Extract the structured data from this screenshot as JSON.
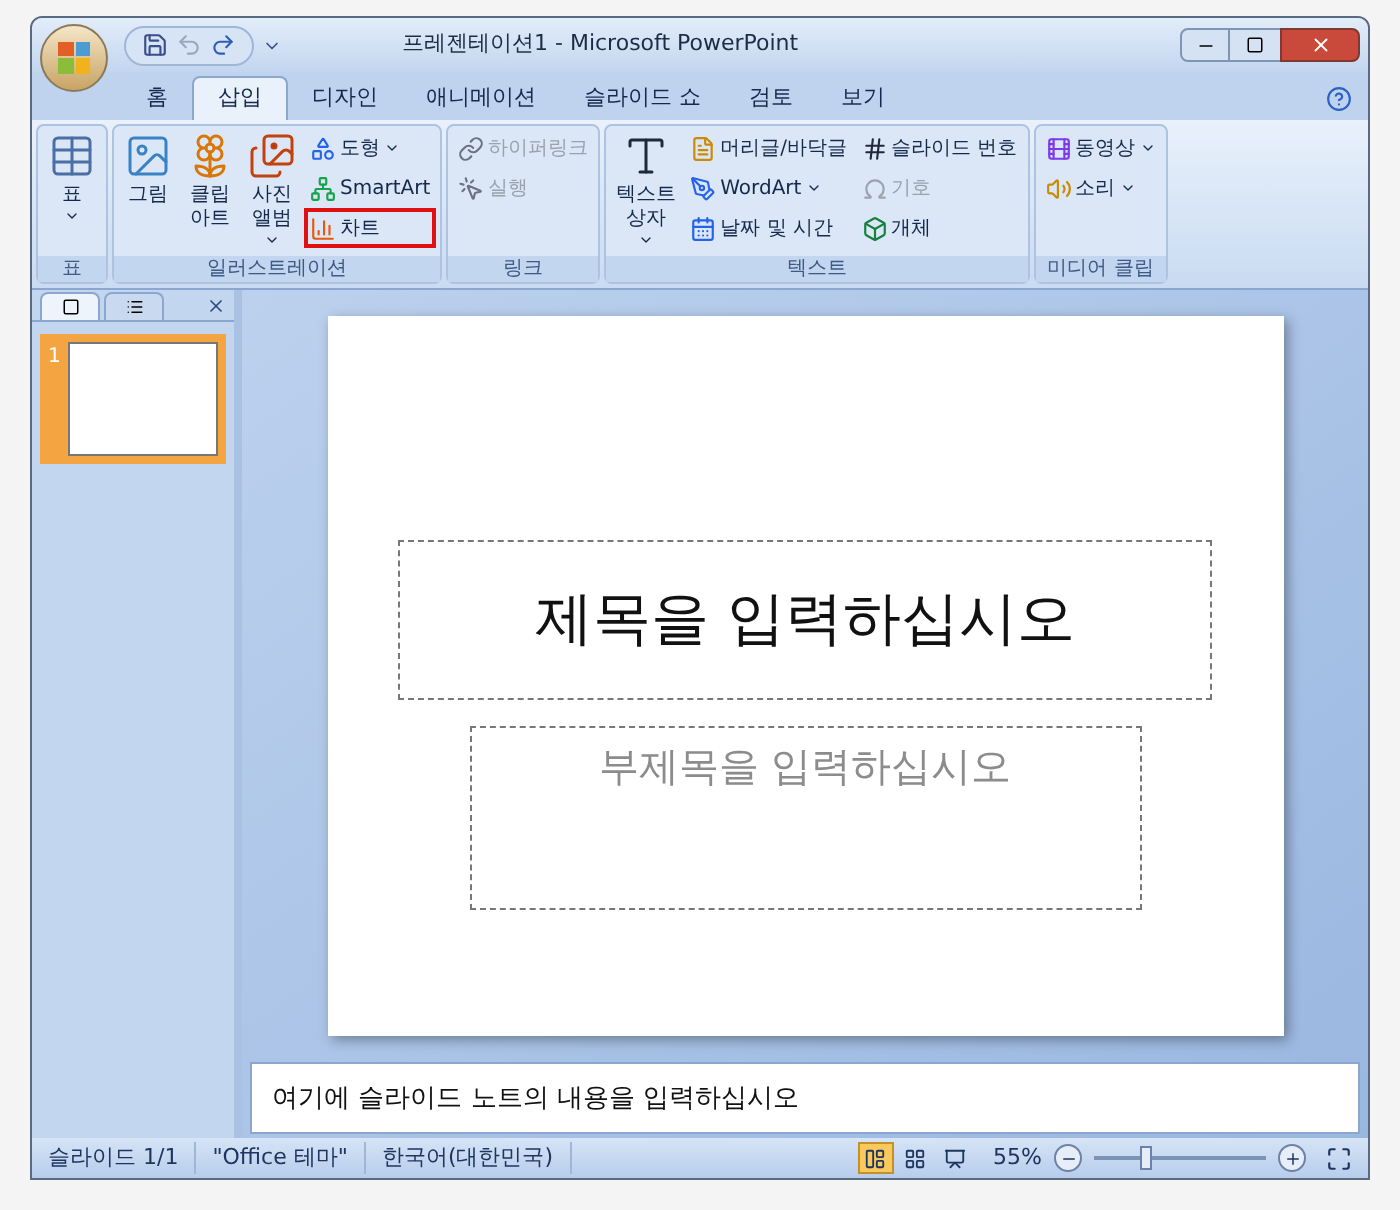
{
  "window": {
    "title": "프레젠테이션1 - Microsoft PowerPoint"
  },
  "tabs": [
    {
      "label": "홈",
      "selected": false
    },
    {
      "label": "삽입",
      "selected": true
    },
    {
      "label": "디자인",
      "selected": false
    },
    {
      "label": "애니메이션",
      "selected": false
    },
    {
      "label": "슬라이드 쇼",
      "selected": false
    },
    {
      "label": "검토",
      "selected": false
    },
    {
      "label": "보기",
      "selected": false
    }
  ],
  "ribbon_groups": [
    {
      "label": "표",
      "columns": [
        [
          {
            "kind": "large",
            "lines": [
              "표"
            ],
            "dropdown": true,
            "disabled": false,
            "highlighted": false
          }
        ]
      ]
    },
    {
      "label": "일러스트레이션",
      "columns": [
        [
          {
            "kind": "large",
            "lines": [
              "그림"
            ],
            "dropdown": false,
            "disabled": false,
            "highlighted": false
          }
        ],
        [
          {
            "kind": "large",
            "lines": [
              "클립",
              "아트"
            ],
            "dropdown": false,
            "disabled": false,
            "highlighted": false
          }
        ],
        [
          {
            "kind": "large",
            "lines": [
              "사진",
              "앨범"
            ],
            "dropdown": true,
            "disabled": false,
            "highlighted": false
          }
        ],
        [
          {
            "kind": "small",
            "lines": [
              "도형"
            ],
            "dropdown": true,
            "disabled": false,
            "highlighted": false
          },
          {
            "kind": "small",
            "lines": [
              "SmartArt"
            ],
            "dropdown": false,
            "disabled": false,
            "highlighted": false
          },
          {
            "kind": "small",
            "lines": [
              "차트"
            ],
            "dropdown": false,
            "disabled": false,
            "highlighted": true
          }
        ]
      ]
    },
    {
      "label": "링크",
      "columns": [
        [
          {
            "kind": "small",
            "lines": [
              "하이퍼링크"
            ],
            "dropdown": false,
            "disabled": true,
            "highlighted": false
          },
          {
            "kind": "small",
            "lines": [
              "실행"
            ],
            "dropdown": false,
            "disabled": true,
            "highlighted": false
          }
        ]
      ]
    },
    {
      "label": "텍스트",
      "columns": [
        [
          {
            "kind": "large",
            "lines": [
              "텍스트",
              "상자"
            ],
            "dropdown": true,
            "disabled": false,
            "highlighted": false
          }
        ],
        [
          {
            "kind": "small",
            "lines": [
              "머리글/바닥글"
            ],
            "dropdown": false,
            "disabled": false,
            "highlighted": false
          },
          {
            "kind": "small",
            "lines": [
              "WordArt"
            ],
            "dropdown": true,
            "disabled": false,
            "highlighted": false
          },
          {
            "kind": "small",
            "lines": [
              "날짜 및 시간"
            ],
            "dropdown": false,
            "disabled": false,
            "highlighted": false
          }
        ],
        [
          {
            "kind": "small",
            "lines": [
              "슬라이드 번호"
            ],
            "dropdown": false,
            "disabled": false,
            "highlighted": false
          },
          {
            "kind": "small",
            "lines": [
              "기호"
            ],
            "dropdown": false,
            "disabled": true,
            "highlighted": false
          },
          {
            "kind": "small",
            "lines": [
              "개체"
            ],
            "dropdown": false,
            "disabled": false,
            "highlighted": false
          }
        ]
      ]
    },
    {
      "label": "미디어 클립",
      "columns": [
        [
          {
            "kind": "small",
            "lines": [
              "동영상"
            ],
            "dropdown": true,
            "disabled": false,
            "highlighted": false
          },
          {
            "kind": "small",
            "lines": [
              "소리"
            ],
            "dropdown": true,
            "disabled": false,
            "highlighted": false
          }
        ]
      ]
    }
  ],
  "slide_panel": {
    "tabs": [
      {
        "selected": true
      },
      {
        "selected": false
      }
    ],
    "thumbnails": [
      {
        "number": "1",
        "selected": true
      }
    ]
  },
  "slide": {
    "title_placeholder": "제목을 입력하십시오",
    "subtitle_placeholder": "부제목을 입력하십시오"
  },
  "notes": {
    "placeholder": "여기에 슬라이드 노트의 내용을 입력하십시오"
  },
  "status_bar": {
    "items": [
      "슬라이드 1/1",
      "\"Office 테마\"",
      "한국어(대한민국)"
    ],
    "views": [
      {
        "selected": true
      },
      {
        "selected": false
      },
      {
        "selected": false
      }
    ],
    "zoom": "55%",
    "zoom_slider": {
      "level": 0.3
    }
  }
}
